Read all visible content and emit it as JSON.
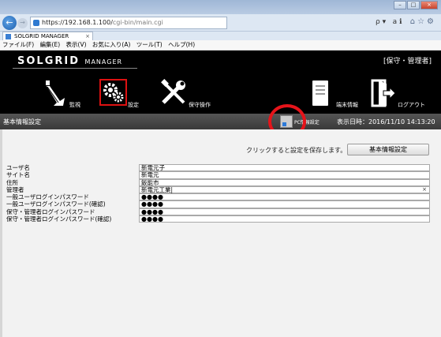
{
  "browser": {
    "url_host": "https://192.168.1.100/",
    "url_path": "cgi-bin/main.cgi",
    "tab_title": "SOLGRID MANAGER",
    "address_tools": "ρ ▾   a ℹ",
    "menu": [
      "ファイル(F)",
      "編集(E)",
      "表示(V)",
      "お気に入り(A)",
      "ツール(T)",
      "ヘルプ(H)"
    ]
  },
  "app": {
    "logo_main": "SOLGRID",
    "logo_sub": "MANAGER",
    "role": "[保守・管理者]",
    "nav": {
      "monitor": "監視",
      "settings": "設定",
      "maintenance": "保守操作",
      "terminal": "端末情報",
      "logout": "ログアウト"
    }
  },
  "subheader": {
    "title": "基本情報設定",
    "pc_label": "PC情報設定",
    "datetime": "表示日時：2016/11/10 14:13:20"
  },
  "content": {
    "hint": "クリックすると設定を保存します。",
    "save_button": "基本情報設定",
    "fields": [
      {
        "label": "ユーザ名",
        "value": "新電元子"
      },
      {
        "label": "サイト名",
        "value": "新電元"
      },
      {
        "label": "住所",
        "value": "飯能市"
      },
      {
        "label": "管理者",
        "value": "新電元工業|"
      },
      {
        "label": "一般ユーザログインパスワード",
        "value": "●●●●"
      },
      {
        "label": "一般ユーザログインパスワード(確認)",
        "value": "●●●●"
      },
      {
        "label": "保守・管理者ログインパスワード",
        "value": "●●●●"
      },
      {
        "label": "保守・管理者ログインパスワード(確認)",
        "value": "●●●●"
      }
    ]
  },
  "colors": {
    "header_bg": "#000000",
    "highlight": "#e6141a",
    "settings_border": "#dd1111"
  },
  "icons": [
    "back-icon",
    "forward-icon",
    "lock-icon",
    "favicon",
    "monitor-icon",
    "gear-icon",
    "tools-icon",
    "terminal-icon",
    "logout-icon",
    "pc-info-icon"
  ]
}
